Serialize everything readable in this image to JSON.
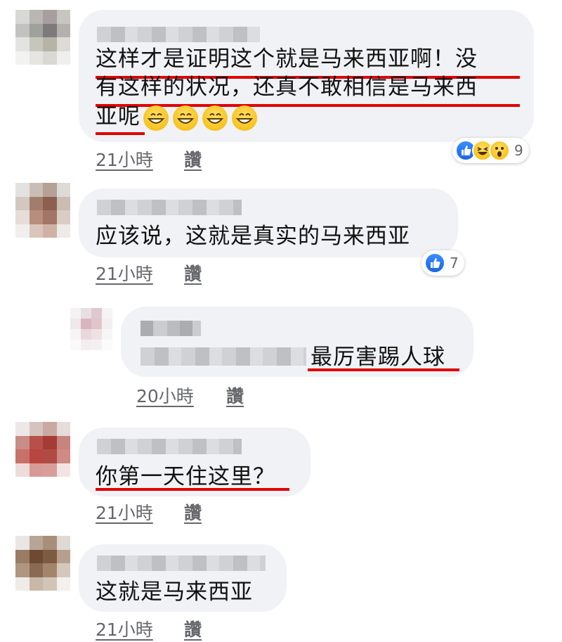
{
  "comments": [
    {
      "text_line1": "这样才是证明这个就是马来西亚啊！没",
      "text_line2": "有这样的状况，还真不敢相信是马来西",
      "text_line3": "亚呢",
      "emoji": [
        "grinning-face",
        "grinning-face",
        "grinning-face",
        "grinning-face"
      ],
      "time": "21小時",
      "like_label": "讚",
      "reactions": [
        "like-icon",
        "haha-icon",
        "wow-icon"
      ],
      "reaction_count": "9"
    },
    {
      "text_line1": "应该说，这就是真实的马来西亚",
      "time": "21小時",
      "like_label": "讚",
      "reactions": [
        "like-icon"
      ],
      "reaction_count": "7"
    },
    {
      "text_line1": "最厉害踢人球",
      "time": "20小時",
      "like_label": "讚",
      "is_reply": true
    },
    {
      "text_line1": "你第一天住这里？",
      "time": "21小時",
      "like_label": "讚"
    },
    {
      "text_line1": "这就是马来西亚",
      "time": "21小時",
      "like_label": "讚"
    }
  ],
  "colors": {
    "bubble": "#f0f2f5",
    "highlight_underline": "#e00000",
    "meta_text": "#65676b",
    "like_blue": "#1a66e0"
  }
}
